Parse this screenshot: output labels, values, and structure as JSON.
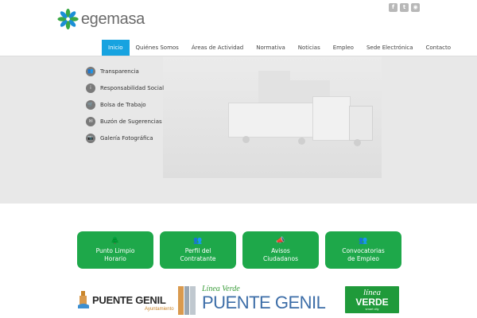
{
  "brand": {
    "name": "egemasa",
    "logo_icon": "flower-logo-icon",
    "colors": {
      "accent_blue": "#17a3e0",
      "tile_green": "#1ea84a",
      "logo_green": "#3aa845",
      "logo_blue": "#1b8fd6"
    }
  },
  "social": [
    {
      "icon": "facebook-icon",
      "glyph": "f"
    },
    {
      "icon": "twitter-icon",
      "glyph": "t"
    },
    {
      "icon": "rss-icon",
      "glyph": "◉"
    }
  ],
  "nav": {
    "items": [
      {
        "label": "Inicio",
        "active": true
      },
      {
        "label": "Quiénes Somos"
      },
      {
        "label": "Áreas de Actividad"
      },
      {
        "label": "Normativa"
      },
      {
        "label": "Noticias"
      },
      {
        "label": "Empleo"
      },
      {
        "label": "Sede Electrónica"
      },
      {
        "label": "Contacto"
      }
    ]
  },
  "side_menu": {
    "items": [
      {
        "label": "Transparencia",
        "icon": "users-icon",
        "glyph": "👥"
      },
      {
        "label": "Responsabilidad Social",
        "icon": "info-icon",
        "glyph": "i"
      },
      {
        "label": "Bolsa de Trabajo",
        "icon": "cart-icon",
        "glyph": "🛒"
      },
      {
        "label": "Buzón de Sugerencias",
        "icon": "mail-icon",
        "glyph": "✉"
      },
      {
        "label": "Galería Fotográfica",
        "icon": "camera-icon",
        "glyph": "📷"
      }
    ]
  },
  "tiles": [
    {
      "label": "Punto Limpio Horario",
      "line1": "Punto Limpio",
      "line2": "Horario",
      "icon": "tree-icon",
      "glyph": "🌲"
    },
    {
      "label": "Perfil del Contratante",
      "line1": "Perfil del",
      "line2": "Contratante",
      "icon": "group-icon",
      "glyph": "👥"
    },
    {
      "label": "Avisos Ciudadanos",
      "line1": "Avisos",
      "line2": "Ciudadanos",
      "icon": "megaphone-icon",
      "glyph": "📣"
    },
    {
      "label": "Convocatorias de Empleo",
      "line1": "Convocatorias",
      "line2": "de Empleo",
      "icon": "group-icon",
      "glyph": "👥"
    }
  ],
  "partners": {
    "puente_genil": {
      "name": "PUENTE GENIL",
      "sub": "Ayuntamiento"
    },
    "linea_verde": {
      "small": "Línea Verde",
      "big": "PUENTE GENIL"
    },
    "badge": {
      "top": "línea",
      "main": "VERDE",
      "sub": "smart city"
    }
  }
}
